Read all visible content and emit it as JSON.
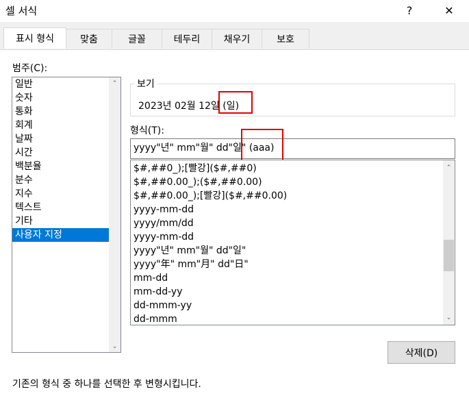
{
  "window": {
    "title": "셀 서식",
    "help_label": "?",
    "close_label": "✕"
  },
  "tabs": [
    {
      "label": "표시 형식"
    },
    {
      "label": "맞춤"
    },
    {
      "label": "글꼴"
    },
    {
      "label": "테두리"
    },
    {
      "label": "채우기"
    },
    {
      "label": "보호"
    }
  ],
  "category": {
    "label": "범주(C):",
    "items": [
      "일반",
      "숫자",
      "통화",
      "회계",
      "날짜",
      "시간",
      "백분율",
      "분수",
      "지수",
      "텍스트",
      "기타",
      "사용자 지정"
    ],
    "selected": "사용자 지정"
  },
  "preview": {
    "label": "보기",
    "value": "2023년 02월 12일 (일)"
  },
  "format": {
    "label": "형식(T):",
    "value": "yyyy\"년\" mm\"월\" dd\"일\" (aaa)",
    "items": [
      "$#,##0_);[빨강]($#,##0)",
      "$#,##0.00_);($#,##0.00)",
      "$#,##0.00_);[빨강]($#,##0.00)",
      "yyyy-mm-dd",
      "yyyy/mm/dd",
      "yyyy-mm-dd",
      "yyyy\"년\" mm\"월\" dd\"일\"",
      "yyyy\"年\" mm\"月\" dd\"日\"",
      "mm-dd",
      "mm-dd-yy",
      "dd-mmm-yy",
      "dd-mmm"
    ]
  },
  "delete_button": {
    "label": "삭제(D)"
  },
  "hint": "기존의 형식 중 하나를 선택한 후 변형시킵니다.",
  "colors": {
    "selection": "#0078d7",
    "highlight_box": "#e00000"
  }
}
